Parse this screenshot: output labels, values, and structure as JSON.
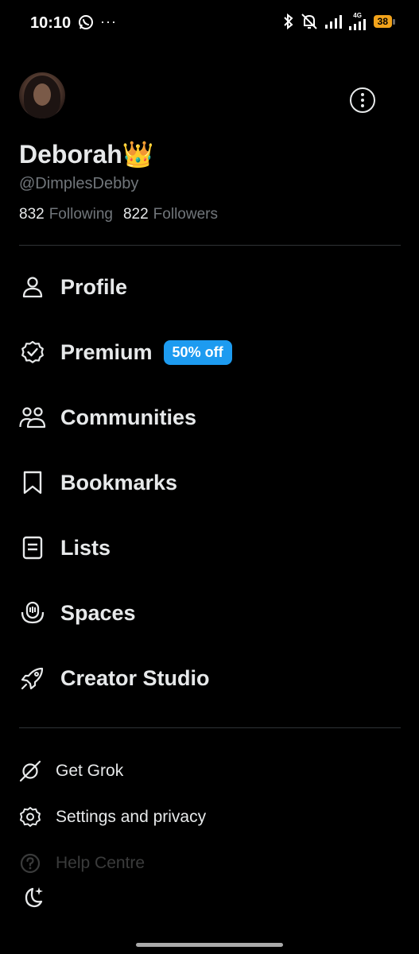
{
  "status_bar": {
    "time": "10:10",
    "more": "···",
    "network": "4G",
    "battery": "38"
  },
  "profile": {
    "display_name": "Deborah",
    "emoji": "👑",
    "handle": "@DimplesDebby",
    "following_count": "832",
    "following_label": "Following",
    "followers_count": "822",
    "followers_label": "Followers"
  },
  "menu": {
    "items": [
      {
        "label": "Profile",
        "icon": "person-icon"
      },
      {
        "label": "Premium",
        "icon": "verified-badge-icon",
        "badge": "50% off"
      },
      {
        "label": "Communities",
        "icon": "people-icon"
      },
      {
        "label": "Bookmarks",
        "icon": "bookmark-icon"
      },
      {
        "label": "Lists",
        "icon": "list-icon"
      },
      {
        "label": "Spaces",
        "icon": "microphone-icon"
      },
      {
        "label": "Creator Studio",
        "icon": "rocket-icon"
      }
    ]
  },
  "secondary_menu": {
    "items": [
      {
        "label": "Get Grok",
        "icon": "grok-icon"
      },
      {
        "label": "Settings and privacy",
        "icon": "gear-icon"
      },
      {
        "label": "Help Centre",
        "icon": "help-icon"
      }
    ]
  },
  "colors": {
    "background": "#000000",
    "text": "#e7e9ea",
    "muted": "#71767b",
    "accent": "#1d9bf0",
    "battery": "#f2a31b"
  }
}
